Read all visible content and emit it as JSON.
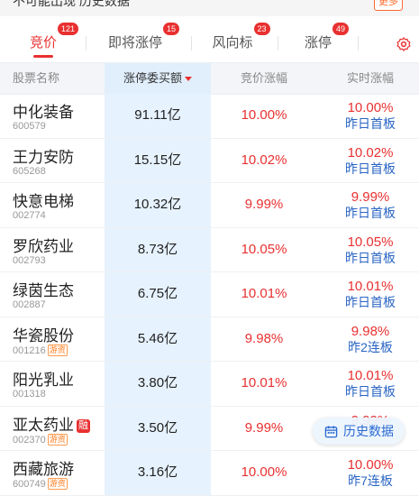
{
  "top_notice": {
    "text": "不可能出现 历史数据",
    "button_label": "更多"
  },
  "tabs": [
    {
      "label": "竞价",
      "badge": "121",
      "active": true
    },
    {
      "label": "即将涨停",
      "badge": "15",
      "active": false
    },
    {
      "label": "风向标",
      "badge": "23",
      "active": false
    },
    {
      "label": "涨停",
      "badge": "49",
      "active": false
    }
  ],
  "columns": {
    "name": "股票名称",
    "amount": "涨停委买额",
    "bid_change": "竞价涨幅",
    "realtime_change": "实时涨幅"
  },
  "rows": [
    {
      "name": "中化装备",
      "code": "600579",
      "tag": "",
      "rong": false,
      "amount": "91.11亿",
      "bid": "10.00%",
      "rt": "10.00%",
      "note": "昨日首板"
    },
    {
      "name": "王力安防",
      "code": "605268",
      "tag": "",
      "rong": false,
      "amount": "15.15亿",
      "bid": "10.02%",
      "rt": "10.02%",
      "note": "昨日首板"
    },
    {
      "name": "快意电梯",
      "code": "002774",
      "tag": "",
      "rong": false,
      "amount": "10.32亿",
      "bid": "9.99%",
      "rt": "9.99%",
      "note": "昨日首板"
    },
    {
      "name": "罗欣药业",
      "code": "002793",
      "tag": "",
      "rong": false,
      "amount": "8.73亿",
      "bid": "10.05%",
      "rt": "10.05%",
      "note": "昨日首板"
    },
    {
      "name": "绿茵生态",
      "code": "002887",
      "tag": "",
      "rong": false,
      "amount": "6.75亿",
      "bid": "10.01%",
      "rt": "10.01%",
      "note": "昨日首板"
    },
    {
      "name": "华瓷股份",
      "code": "001216",
      "tag": "游资",
      "rong": false,
      "amount": "5.46亿",
      "bid": "9.98%",
      "rt": "9.98%",
      "note": "昨2连板"
    },
    {
      "name": "阳光乳业",
      "code": "001318",
      "tag": "",
      "rong": false,
      "amount": "3.80亿",
      "bid": "10.01%",
      "rt": "10.01%",
      "note": "昨日首板"
    },
    {
      "name": "亚太药业",
      "code": "002370",
      "tag": "游资",
      "rong": true,
      "amount": "3.50亿",
      "bid": "9.99%",
      "rt": "9.99%",
      "note": ""
    },
    {
      "name": "西藏旅游",
      "code": "600749",
      "tag": "游资",
      "rong": false,
      "amount": "3.16亿",
      "bid": "10.00%",
      "rt": "10.00%",
      "note": "昨7连板"
    }
  ],
  "rong_label": "融",
  "history_button": {
    "label": "历史数据",
    "icon": "calendar-icon"
  },
  "settings_icon": "gear-icon",
  "colors": {
    "accent": "#e93030",
    "blue_text": "#2a65c4",
    "highlight_col": "#e6f2fd"
  }
}
